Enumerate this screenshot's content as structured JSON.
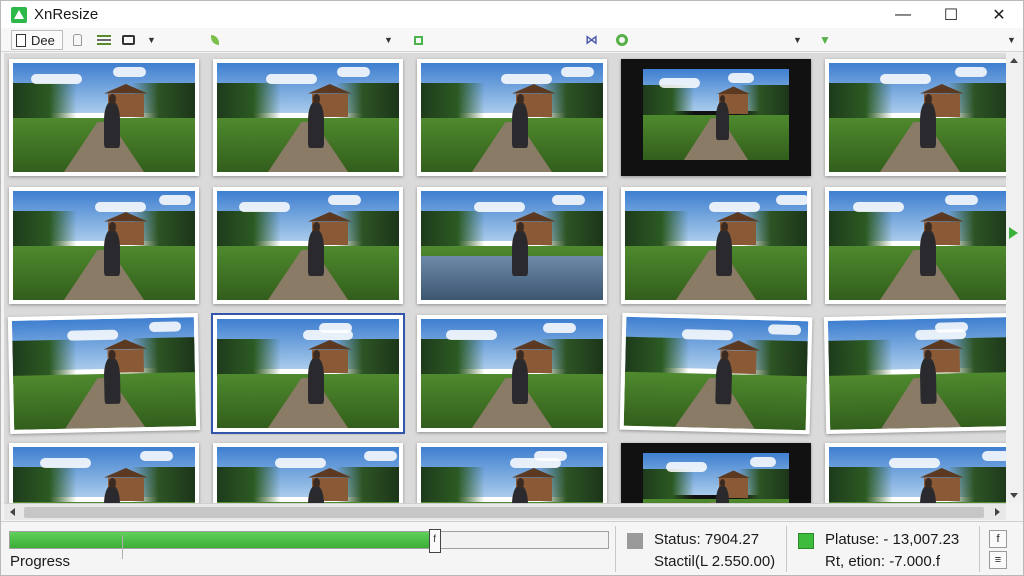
{
  "window": {
    "title": "XnResize",
    "controls": {
      "minimize": "—",
      "maximize": "☐",
      "close": "✕"
    }
  },
  "toolbar": {
    "doc_label": "Dee",
    "dropdown_glyph": "▼"
  },
  "thumbnails": [
    {
      "style": "normal"
    },
    {
      "style": "normal"
    },
    {
      "style": "normal"
    },
    {
      "style": "dark"
    },
    {
      "style": "normal"
    },
    {
      "style": "normal"
    },
    {
      "style": "normal"
    },
    {
      "style": "water"
    },
    {
      "style": "normal"
    },
    {
      "style": "normal"
    },
    {
      "style": "tilt-l"
    },
    {
      "style": "selected"
    },
    {
      "style": "normal"
    },
    {
      "style": "tilt-r"
    },
    {
      "style": "tilt-l"
    },
    {
      "style": "normal"
    },
    {
      "style": "normal"
    },
    {
      "style": "normal"
    },
    {
      "style": "dark"
    },
    {
      "style": "normal"
    }
  ],
  "status": {
    "progress_label": "Progress",
    "progress_value": 0.71,
    "handle_glyph": "f",
    "left_square_color": "#9a9a9a",
    "right_square_color": "#3cbb3c",
    "status_line": "Status:   7904.27",
    "static_line": "Stactil(L  2.550.00)",
    "platuse_line": "Platuse: -  13,007.23",
    "retion_line": "Rt, etion: -7.000.f",
    "side_btn_top": "f",
    "side_btn_bottom": "≡"
  },
  "colors": {
    "accent_green": "#3cae35",
    "title_bg": "#ffffff"
  }
}
